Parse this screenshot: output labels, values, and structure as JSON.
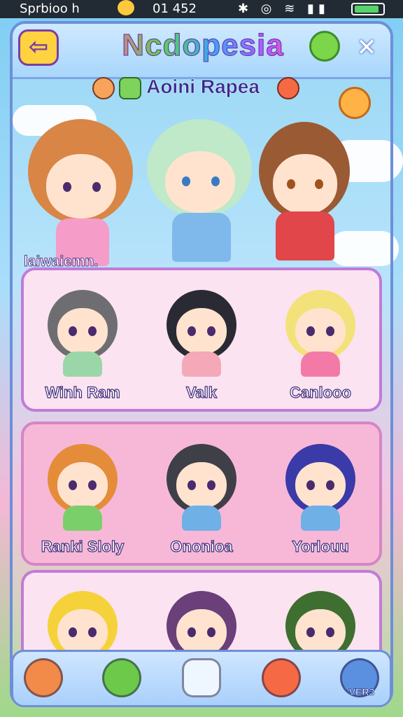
{
  "status_bar": {
    "app_label": "Sprbioo h",
    "time": "01 452",
    "icons": [
      "bluetooth-icon",
      "alarm-icon",
      "wifi-icon",
      "signal-icon",
      "battery-icon"
    ]
  },
  "header": {
    "title": "Ncdopesia",
    "subtitle": "Aoini Rapea",
    "back_icon": "back-arrow-icon",
    "close_symbol": "✕",
    "back_symbol": "⇦"
  },
  "hero": {
    "label": "laiwaiemn."
  },
  "grid": {
    "rows": [
      {
        "items": [
          {
            "name": "Winh Ram",
            "hair": "#6e6e72",
            "outfit": "#9bd6a8"
          },
          {
            "name": "Valk",
            "hair": "#2a2a34",
            "outfit": "#f4a8b8"
          },
          {
            "name": "Canlooo",
            "hair": "#f3e27a",
            "outfit": "#f37aa6"
          }
        ]
      },
      {
        "items": [
          {
            "name": "Ranki Sloly",
            "hair": "#e48c3a",
            "outfit": "#7bcf6a"
          },
          {
            "name": "Ononioa",
            "hair": "#3f3f48",
            "outfit": "#6fb0e6"
          },
          {
            "name": "Yorlouu",
            "hair": "#3a3aa8",
            "outfit": "#6fb0e6"
          }
        ]
      },
      {
        "items": [
          {
            "name": "",
            "hair": "#f5d23a",
            "outfit": "#7bcf6a"
          },
          {
            "name": "",
            "hair": "#6a3f7a",
            "outfit": "#f4a8b8"
          },
          {
            "name": "",
            "hair": "#3e6e30",
            "outfit": "#f4a8b8"
          }
        ]
      }
    ]
  },
  "navbar": {
    "items": [
      {
        "icon": "bear-icon",
        "color": "#f28a4a"
      },
      {
        "icon": "leaf-icon",
        "color": "#6cc94a"
      },
      {
        "icon": "robot-icon",
        "color": "#eef6ff"
      },
      {
        "icon": "cat-icon",
        "color": "#f56a44"
      },
      {
        "icon": "crystal-icon",
        "color": "#5b8fe0",
        "label": "VER3"
      }
    ]
  },
  "colors": {
    "frame": "#6d8fd8",
    "card_border": "#c17ad7"
  }
}
